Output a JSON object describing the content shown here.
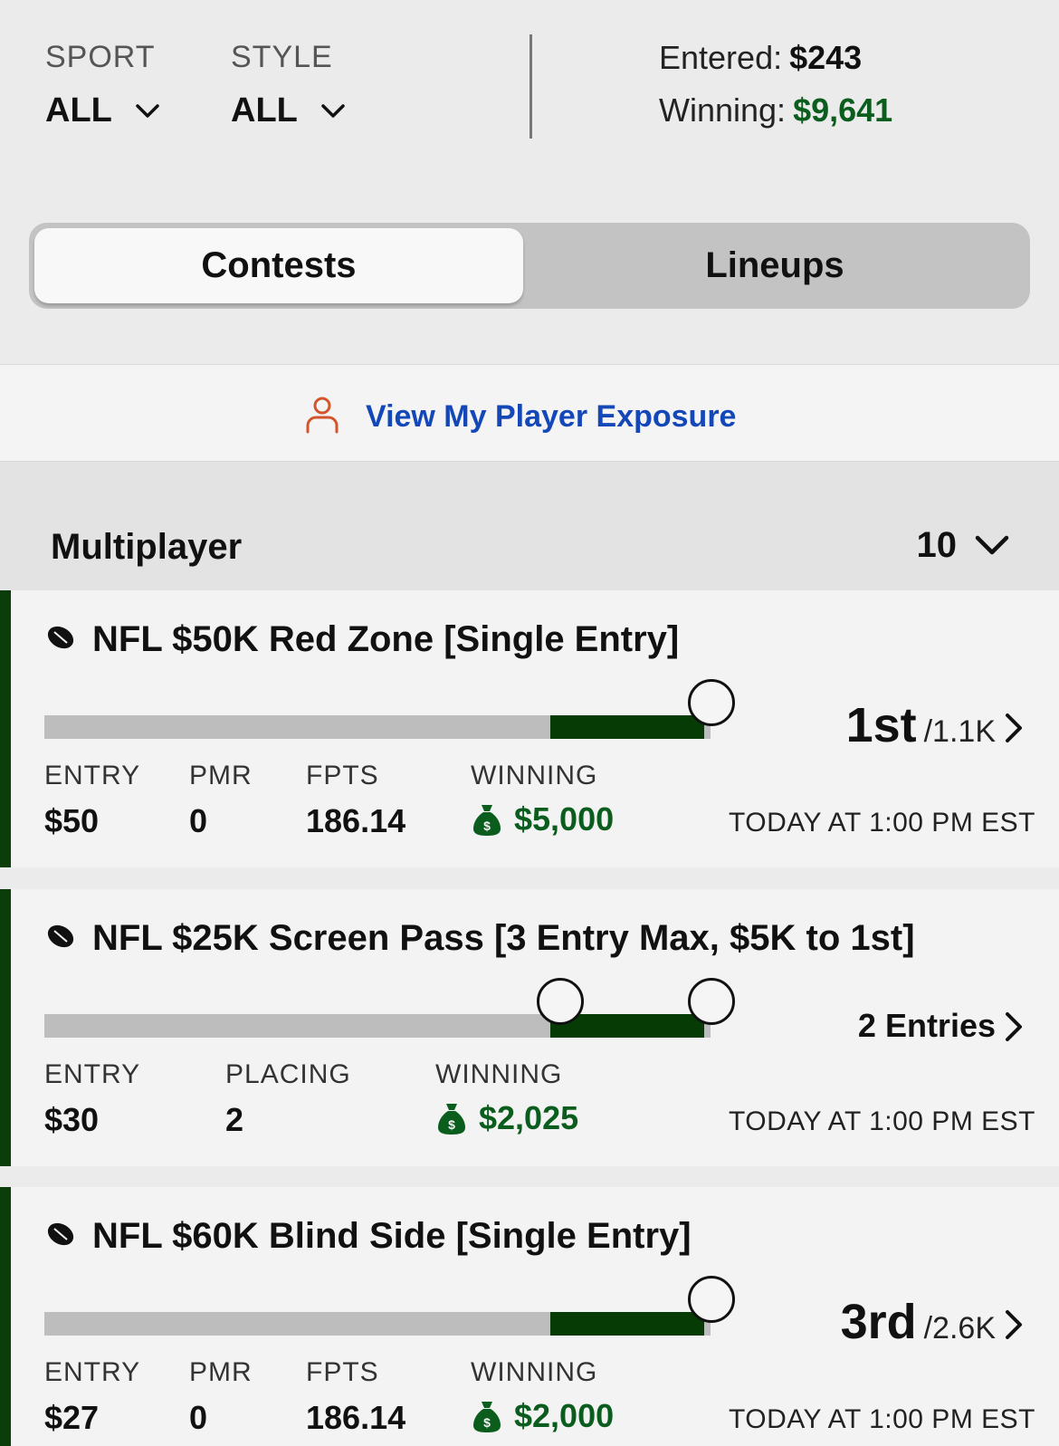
{
  "filters": {
    "sport": {
      "label": "SPORT",
      "value": "ALL"
    },
    "style": {
      "label": "STYLE",
      "value": "ALL"
    }
  },
  "stats": {
    "entered_label": "Entered:",
    "entered_value": "$243",
    "winning_label": "Winning:",
    "winning_value": "$9,641"
  },
  "tabs": {
    "contests": "Contests",
    "lineups": "Lineups",
    "active": "contests"
  },
  "exposure": {
    "label": "View My Player Exposure",
    "icon": "person-icon"
  },
  "section": {
    "title": "Multiplayer",
    "count": "10"
  },
  "colors": {
    "accent_green": "#063b06",
    "money_green": "#0b5d1e",
    "link_blue": "#1447b8",
    "person_icon": "#d2552b"
  },
  "contests": [
    {
      "title": "NFL $50K Red Zone [Single Entry]",
      "rank": "1st",
      "total": "/1.1K",
      "progress_start": 0.76,
      "progress_end": 0.99,
      "labels": [
        "ENTRY",
        "PMR",
        "FPTS",
        "WINNING"
      ],
      "values": [
        "$50",
        "0",
        "186.14",
        "$5,000"
      ],
      "time": "TODAY AT 1:00 PM EST"
    },
    {
      "title": "NFL $25K Screen Pass [3 Entry Max, $5K to 1st]",
      "entries": "2 Entries",
      "progress_start": 0.76,
      "progress_end": 0.99,
      "labels": [
        "ENTRY",
        "PLACING",
        "WINNING"
      ],
      "values": [
        "$30",
        "2",
        "$2,025"
      ],
      "time": "TODAY AT 1:00 PM EST"
    },
    {
      "title": "NFL $60K Blind Side [Single Entry]",
      "rank": "3rd",
      "total": "/2.6K",
      "progress_start": 0.76,
      "progress_end": 0.99,
      "labels": [
        "ENTRY",
        "PMR",
        "FPTS",
        "WINNING"
      ],
      "values": [
        "$27",
        "0",
        "186.14",
        "$2,000"
      ],
      "time": "TODAY AT 1:00 PM EST"
    }
  ]
}
